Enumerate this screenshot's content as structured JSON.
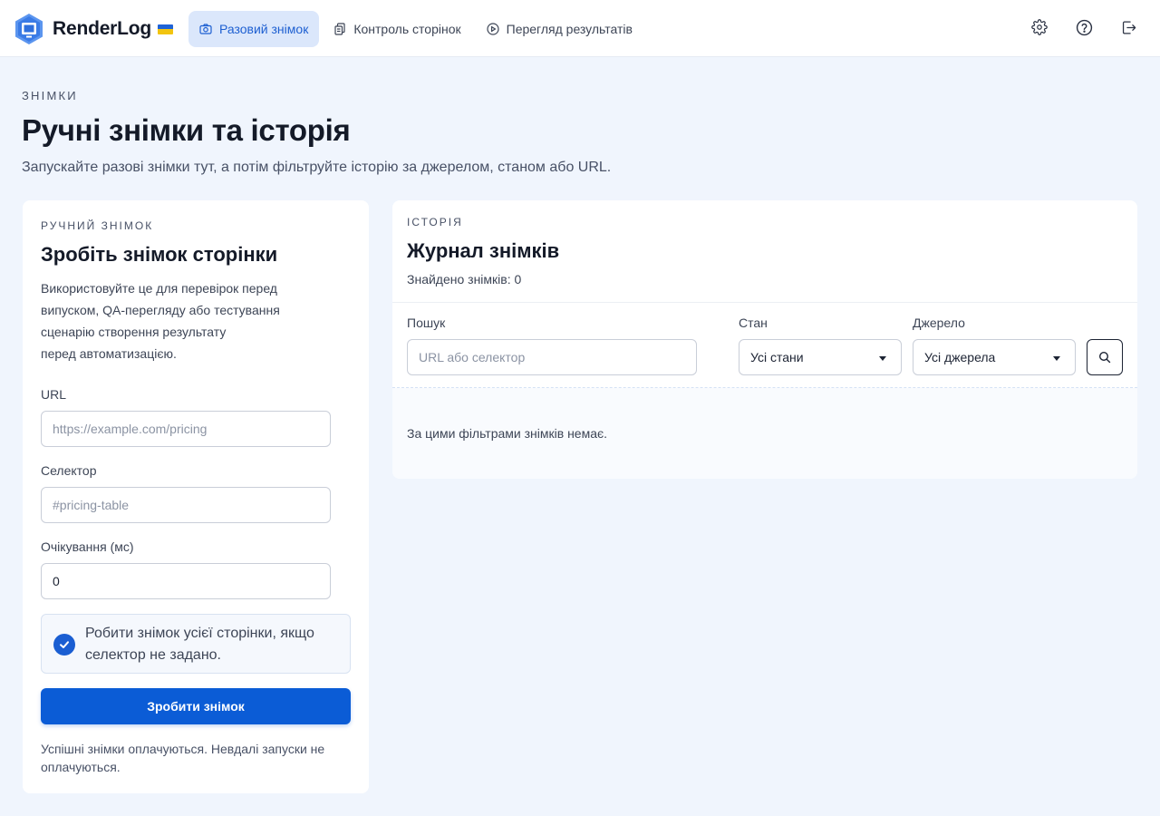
{
  "app": {
    "name": "RenderLog"
  },
  "nav": {
    "tabs": [
      {
        "label": "Разовий знімок",
        "icon": "camera-icon",
        "active": true
      },
      {
        "label": "Контроль сторінок",
        "icon": "pages-copy-icon",
        "active": false
      },
      {
        "label": "Перегляд результатів",
        "icon": "play-circle-icon",
        "active": false
      }
    ],
    "icons": [
      "gear-icon",
      "help-icon",
      "logout-icon"
    ]
  },
  "header": {
    "eyebrow": "ЗНІМКИ",
    "title": "Ручні знімки та історія",
    "subtitle": "Запускайте разові знімки тут, а потім фільтруйте історію за джерелом, станом або URL."
  },
  "manual": {
    "eyebrow": "РУЧНИЙ ЗНІМОК",
    "title": "Зробіть знімок сторінки",
    "description_lines": [
      "Використовуйте це для перевірок перед",
      "випуском, QA-перегляду або тестування",
      "сценарію створення результату",
      "перед автоматизацією."
    ],
    "url_label": "URL",
    "url_placeholder": "https://example.com/pricing",
    "selector_label": "Селектор",
    "selector_placeholder": "#pricing-table",
    "wait_label": "Очікування (мс)",
    "wait_value": "0",
    "full_page_checked": true,
    "full_page_lines": [
      "Робити знімок усієї сторінки, якщо",
      "селектор не задано."
    ],
    "submit_label": "Зробити знімок",
    "note_lines": [
      "Успішні знімки оплачуються. Невдалі запуски не",
      "оплачуються."
    ]
  },
  "history": {
    "eyebrow": "ІСТОРІЯ",
    "title": "Журнал знімків",
    "count_text": "Знайдено знімків: 0",
    "search_label": "Пошук",
    "search_placeholder": "URL або селектор",
    "state_label": "Стан",
    "state_value": "Усі стани",
    "source_label": "Джерело",
    "source_value": "Усі джерела",
    "empty_text": "За цими фільтрами знімків немає."
  },
  "colors": {
    "accent": "#0b5cd6",
    "accent_soft": "#dbe7fb",
    "page_bg": "#f0f5fd"
  }
}
